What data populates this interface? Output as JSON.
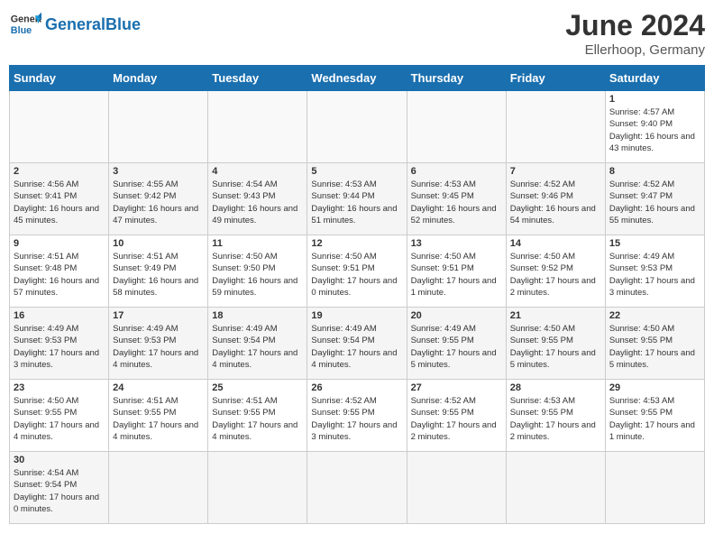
{
  "header": {
    "logo_general": "General",
    "logo_blue": "Blue",
    "month_title": "June 2024",
    "subtitle": "Ellerhoop, Germany"
  },
  "weekdays": [
    "Sunday",
    "Monday",
    "Tuesday",
    "Wednesday",
    "Thursday",
    "Friday",
    "Saturday"
  ],
  "weeks": [
    [
      {
        "day": "",
        "info": ""
      },
      {
        "day": "",
        "info": ""
      },
      {
        "day": "",
        "info": ""
      },
      {
        "day": "",
        "info": ""
      },
      {
        "day": "",
        "info": ""
      },
      {
        "day": "",
        "info": ""
      },
      {
        "day": "1",
        "info": "Sunrise: 4:57 AM\nSunset: 9:40 PM\nDaylight: 16 hours\nand 43 minutes."
      }
    ],
    [
      {
        "day": "2",
        "info": "Sunrise: 4:56 AM\nSunset: 9:41 PM\nDaylight: 16 hours\nand 45 minutes."
      },
      {
        "day": "3",
        "info": "Sunrise: 4:55 AM\nSunset: 9:42 PM\nDaylight: 16 hours\nand 47 minutes."
      },
      {
        "day": "4",
        "info": "Sunrise: 4:54 AM\nSunset: 9:43 PM\nDaylight: 16 hours\nand 49 minutes."
      },
      {
        "day": "5",
        "info": "Sunrise: 4:53 AM\nSunset: 9:44 PM\nDaylight: 16 hours\nand 51 minutes."
      },
      {
        "day": "6",
        "info": "Sunrise: 4:53 AM\nSunset: 9:45 PM\nDaylight: 16 hours\nand 52 minutes."
      },
      {
        "day": "7",
        "info": "Sunrise: 4:52 AM\nSunset: 9:46 PM\nDaylight: 16 hours\nand 54 minutes."
      },
      {
        "day": "8",
        "info": "Sunrise: 4:52 AM\nSunset: 9:47 PM\nDaylight: 16 hours\nand 55 minutes."
      }
    ],
    [
      {
        "day": "9",
        "info": "Sunrise: 4:51 AM\nSunset: 9:48 PM\nDaylight: 16 hours\nand 57 minutes."
      },
      {
        "day": "10",
        "info": "Sunrise: 4:51 AM\nSunset: 9:49 PM\nDaylight: 16 hours\nand 58 minutes."
      },
      {
        "day": "11",
        "info": "Sunrise: 4:50 AM\nSunset: 9:50 PM\nDaylight: 16 hours\nand 59 minutes."
      },
      {
        "day": "12",
        "info": "Sunrise: 4:50 AM\nSunset: 9:51 PM\nDaylight: 17 hours\nand 0 minutes."
      },
      {
        "day": "13",
        "info": "Sunrise: 4:50 AM\nSunset: 9:51 PM\nDaylight: 17 hours\nand 1 minute."
      },
      {
        "day": "14",
        "info": "Sunrise: 4:50 AM\nSunset: 9:52 PM\nDaylight: 17 hours\nand 2 minutes."
      },
      {
        "day": "15",
        "info": "Sunrise: 4:49 AM\nSunset: 9:53 PM\nDaylight: 17 hours\nand 3 minutes."
      }
    ],
    [
      {
        "day": "16",
        "info": "Sunrise: 4:49 AM\nSunset: 9:53 PM\nDaylight: 17 hours\nand 3 minutes."
      },
      {
        "day": "17",
        "info": "Sunrise: 4:49 AM\nSunset: 9:53 PM\nDaylight: 17 hours\nand 4 minutes."
      },
      {
        "day": "18",
        "info": "Sunrise: 4:49 AM\nSunset: 9:54 PM\nDaylight: 17 hours\nand 4 minutes."
      },
      {
        "day": "19",
        "info": "Sunrise: 4:49 AM\nSunset: 9:54 PM\nDaylight: 17 hours\nand 4 minutes."
      },
      {
        "day": "20",
        "info": "Sunrise: 4:49 AM\nSunset: 9:55 PM\nDaylight: 17 hours\nand 5 minutes."
      },
      {
        "day": "21",
        "info": "Sunrise: 4:50 AM\nSunset: 9:55 PM\nDaylight: 17 hours\nand 5 minutes."
      },
      {
        "day": "22",
        "info": "Sunrise: 4:50 AM\nSunset: 9:55 PM\nDaylight: 17 hours\nand 5 minutes."
      }
    ],
    [
      {
        "day": "23",
        "info": "Sunrise: 4:50 AM\nSunset: 9:55 PM\nDaylight: 17 hours\nand 4 minutes."
      },
      {
        "day": "24",
        "info": "Sunrise: 4:51 AM\nSunset: 9:55 PM\nDaylight: 17 hours\nand 4 minutes."
      },
      {
        "day": "25",
        "info": "Sunrise: 4:51 AM\nSunset: 9:55 PM\nDaylight: 17 hours\nand 4 minutes."
      },
      {
        "day": "26",
        "info": "Sunrise: 4:52 AM\nSunset: 9:55 PM\nDaylight: 17 hours\nand 3 minutes."
      },
      {
        "day": "27",
        "info": "Sunrise: 4:52 AM\nSunset: 9:55 PM\nDaylight: 17 hours\nand 2 minutes."
      },
      {
        "day": "28",
        "info": "Sunrise: 4:53 AM\nSunset: 9:55 PM\nDaylight: 17 hours\nand 2 minutes."
      },
      {
        "day": "29",
        "info": "Sunrise: 4:53 AM\nSunset: 9:55 PM\nDaylight: 17 hours\nand 1 minute."
      }
    ],
    [
      {
        "day": "30",
        "info": "Sunrise: 4:54 AM\nSunset: 9:54 PM\nDaylight: 17 hours\nand 0 minutes."
      },
      {
        "day": "",
        "info": ""
      },
      {
        "day": "",
        "info": ""
      },
      {
        "day": "",
        "info": ""
      },
      {
        "day": "",
        "info": ""
      },
      {
        "day": "",
        "info": ""
      },
      {
        "day": "",
        "info": ""
      }
    ]
  ]
}
